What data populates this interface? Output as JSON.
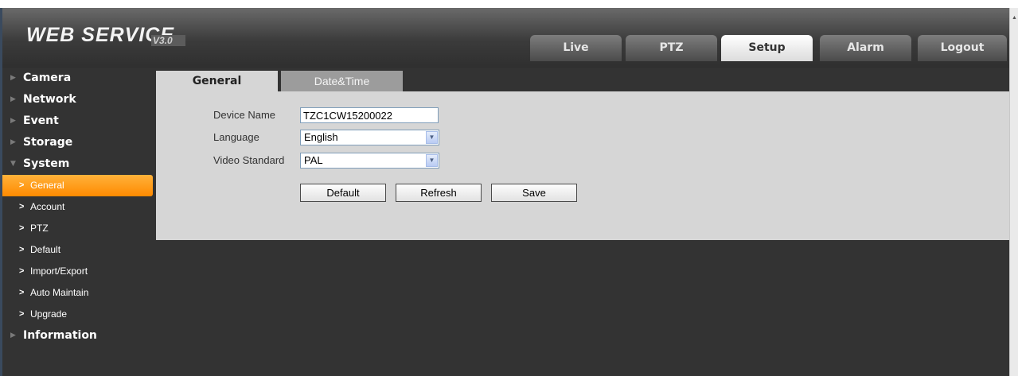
{
  "app": {
    "logo_text": "WEB SERVICE",
    "logo_version": "V3.0"
  },
  "topnav": {
    "items": [
      {
        "label": "Live"
      },
      {
        "label": "PTZ"
      },
      {
        "label": "Setup",
        "active": true
      },
      {
        "label": "Alarm"
      },
      {
        "label": "Logout"
      }
    ]
  },
  "sidebar": {
    "categories": {
      "camera": "Camera",
      "network": "Network",
      "event": "Event",
      "storage": "Storage",
      "system": "System",
      "information": "Information"
    },
    "system_items": [
      {
        "label": "General",
        "active": true
      },
      {
        "label": "Account"
      },
      {
        "label": "PTZ"
      },
      {
        "label": "Default"
      },
      {
        "label": "Import/Export"
      },
      {
        "label": "Auto Maintain"
      },
      {
        "label": "Upgrade"
      }
    ]
  },
  "tabs": {
    "general": "General",
    "datetime": "Date&Time"
  },
  "form": {
    "device_name_label": "Device Name",
    "device_name_value": "TZC1CW15200022",
    "language_label": "Language",
    "language_value": "English",
    "video_standard_label": "Video Standard",
    "video_standard_value": "PAL"
  },
  "buttons": {
    "default": "Default",
    "refresh": "Refresh",
    "save": "Save"
  },
  "colors": {
    "active_menu": "#ff9a1a",
    "background": "#333333",
    "panel": "#d6d6d6"
  }
}
